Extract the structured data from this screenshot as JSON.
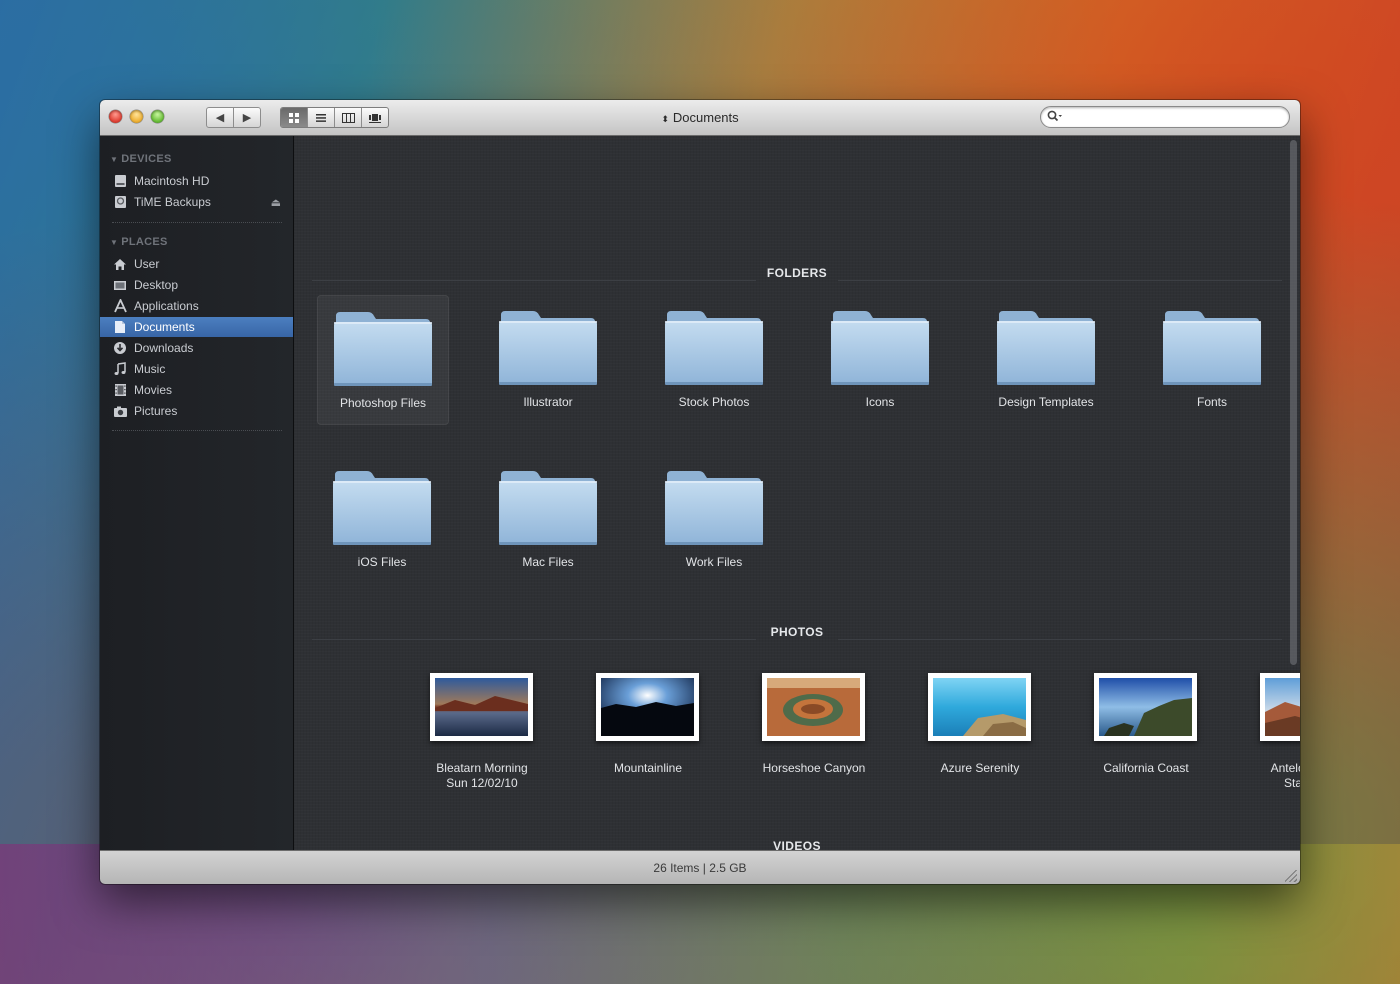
{
  "window": {
    "title": "Documents",
    "search_placeholder": ""
  },
  "toolbar": {
    "back": "◀",
    "forward": "▶"
  },
  "sidebar": {
    "devices_heading": "DEVICES",
    "devices": [
      {
        "label": "Macintosh HD",
        "icon": "hard-drive-icon"
      },
      {
        "label": "TiME Backups",
        "icon": "backup-drive-icon"
      }
    ],
    "places_heading": "PLACES",
    "places": [
      {
        "label": "User",
        "icon": "home-icon"
      },
      {
        "label": "Desktop",
        "icon": "desktop-icon"
      },
      {
        "label": "Applications",
        "icon": "applications-icon"
      },
      {
        "label": "Documents",
        "icon": "documents-icon"
      },
      {
        "label": "Downloads",
        "icon": "downloads-icon"
      },
      {
        "label": "Music",
        "icon": "music-icon"
      },
      {
        "label": "Movies",
        "icon": "movies-icon"
      },
      {
        "label": "Pictures",
        "icon": "pictures-icon"
      }
    ],
    "selected": "Documents"
  },
  "sections": {
    "folders": "FOLDERS",
    "photos": "PHOTOS",
    "videos": "VIDEOS"
  },
  "folders": [
    "Photoshop Files",
    "Illustrator",
    "Stock Photos",
    "Icons",
    "Design Templates",
    "Fonts",
    "iOS Files",
    "Mac Files",
    "Work Files"
  ],
  "photos": [
    {
      "line1": "Bleatarn Morning",
      "line2": "Sun 12/02/10"
    },
    {
      "line1": "Mountainline",
      "line2": ""
    },
    {
      "line1": "Horseshoe Canyon",
      "line2": ""
    },
    {
      "line1": "Azure Serenity",
      "line2": ""
    },
    {
      "line1": "California Coast",
      "line2": ""
    },
    {
      "line1": "Antelope Island",
      "line2": "State Park"
    }
  ],
  "status": {
    "text": "26 Items | 2.5 GB"
  },
  "colors": {
    "selection": "#3f6fb0",
    "folder": "#a9c9e6",
    "content_bg": "#2e3034"
  }
}
